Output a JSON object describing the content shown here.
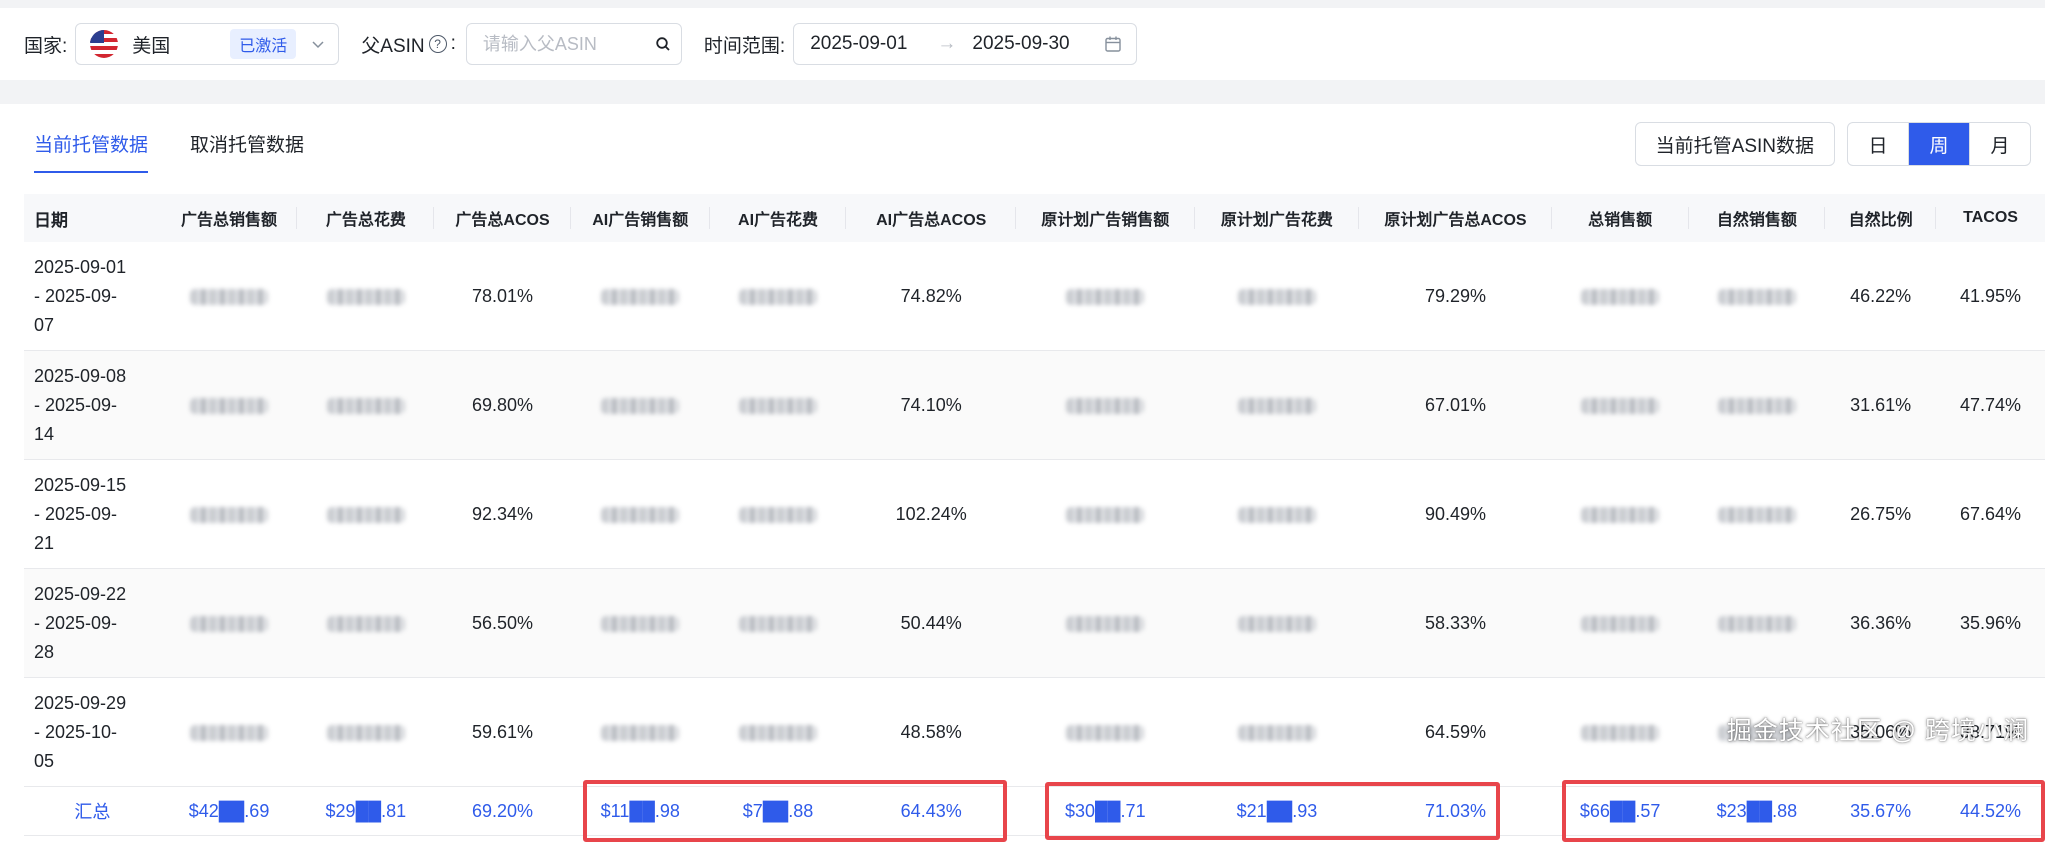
{
  "filters": {
    "country_label": "国家:",
    "country_value": "美国",
    "country_status": "已激活",
    "asin_label": "父ASIN",
    "asin_placeholder": "请输入父ASIN",
    "date_label": "时间范围:",
    "date_start": "2025-09-01",
    "date_end": "2025-09-30"
  },
  "tabs": [
    "当前托管数据",
    "取消托管数据"
  ],
  "toolbar": {
    "asin_data_button": "当前托管ASIN数据",
    "period_options": [
      "日",
      "周",
      "月"
    ],
    "period_selected": "周"
  },
  "table": {
    "headers": [
      "日期",
      "广告总销售额",
      "广告总花费",
      "广告总ACOS",
      "AI广告销售额",
      "AI广告花费",
      "AI广告总ACOS",
      "原计划广告销售额",
      "原计划广告花费",
      "原计划广告总ACOS",
      "总销售额",
      "自然销售额",
      "自然比例",
      "TACOS"
    ],
    "rows": [
      {
        "date_line1": "2025-09-01",
        "date_line2": "- 2025-09-",
        "date_line3": "07",
        "ad_acos": "78.01%",
        "ai_acos": "74.82%",
        "orig_acos": "79.29%",
        "natural_ratio": "46.22%",
        "tacos": "41.95%"
      },
      {
        "date_line1": "2025-09-08",
        "date_line2": "- 2025-09-",
        "date_line3": "14",
        "ad_acos": "69.80%",
        "ai_acos": "74.10%",
        "orig_acos": "67.01%",
        "natural_ratio": "31.61%",
        "tacos": "47.74%"
      },
      {
        "date_line1": "2025-09-15",
        "date_line2": "- 2025-09-",
        "date_line3": "21",
        "ad_acos": "92.34%",
        "ai_acos": "102.24%",
        "orig_acos": "90.49%",
        "natural_ratio": "26.75%",
        "tacos": "67.64%"
      },
      {
        "date_line1": "2025-09-22",
        "date_line2": "- 2025-09-",
        "date_line3": "28",
        "ad_acos": "56.50%",
        "ai_acos": "50.44%",
        "orig_acos": "58.33%",
        "natural_ratio": "36.36%",
        "tacos": "35.96%"
      },
      {
        "date_line1": "2025-09-29",
        "date_line2": "- 2025-10-",
        "date_line3": "05",
        "ad_acos": "59.61%",
        "ai_acos": "48.58%",
        "orig_acos": "64.59%",
        "natural_ratio": "35.06%",
        "tacos": "38.71%"
      }
    ],
    "total": {
      "label": "汇总",
      "ad_sales": "$42██.69",
      "ad_spend": "$29██.81",
      "ad_acos": "69.20%",
      "ai_sales": "$11██.98",
      "ai_spend": "$7██.88",
      "ai_acos": "64.43%",
      "orig_sales": "$30██.71",
      "orig_spend": "$21██.93",
      "orig_acos": "71.03%",
      "total_sales": "$66██.57",
      "natural_sales": "$23██.88",
      "natural_ratio": "35.67%",
      "tacos": "44.52%"
    }
  },
  "watermark": "掘金技术社区 @ 跨境小澜",
  "colors": {
    "accent": "#2f5bea",
    "highlight": "#e8454b"
  },
  "icons": [
    "us-flag-icon",
    "chevron-down-icon",
    "help-icon",
    "search-icon",
    "arrow-right-icon",
    "calendar-icon"
  ]
}
